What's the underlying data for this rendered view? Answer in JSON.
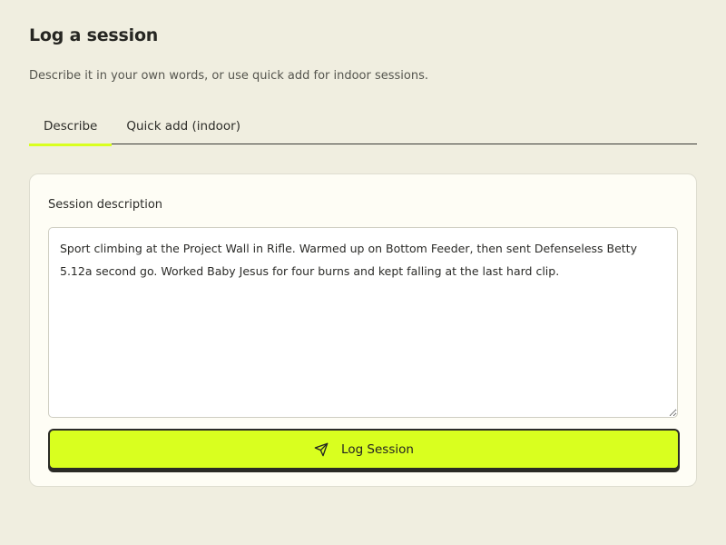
{
  "header": {
    "title": "Log a session",
    "subtitle": "Describe it in your own words, or use quick add for indoor sessions."
  },
  "tabs": [
    {
      "label": "Describe",
      "active": true
    },
    {
      "label": "Quick add (indoor)",
      "active": false
    }
  ],
  "form": {
    "description_label": "Session description",
    "description_value": "Sport climbing at the Project Wall in Rifle. Warmed up on Bottom Feeder, then sent Defenseless Betty 5.12a second go. Worked Baby Jesus for four burns and kept falling at the last hard clip.",
    "submit_label": "Log Session",
    "submit_icon": "send-icon"
  },
  "colors": {
    "accent": "#d9ff1f",
    "background": "#f0eee0",
    "card": "#fefdf5"
  }
}
